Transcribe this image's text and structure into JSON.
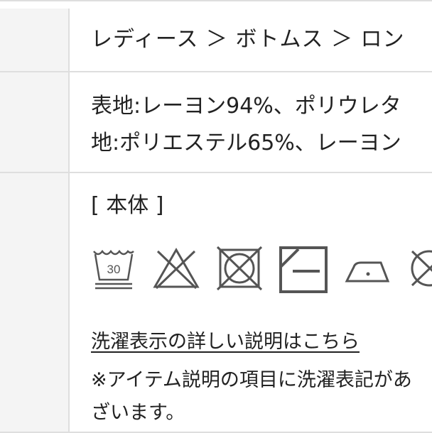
{
  "breadcrumb": {
    "text": "レディース ＞ ボトムス ＞ ロン"
  },
  "material": {
    "line1": "表地:レーヨン94%、ポリウレタ",
    "line2": "地:ポリエステル65%、レーヨン"
  },
  "care": {
    "section_label": "[ 本体 ]",
    "wash_temp": "30",
    "icons": [
      "wash-30-icon",
      "no-bleach-icon",
      "no-tumble-dry-icon",
      "dry-flat-shade-icon",
      "low-iron-icon",
      "no-dry-clean-icon"
    ],
    "detail_link": "洗濯表示の詳しい説明はこちら",
    "note_line1": "※アイテム説明の項目に洗濯表記があ",
    "note_line2": "ざいます。"
  },
  "colors": {
    "border": "#dedede",
    "header_bg": "#f4f4f4",
    "icon_stroke": "#555555",
    "text": "#222222"
  }
}
